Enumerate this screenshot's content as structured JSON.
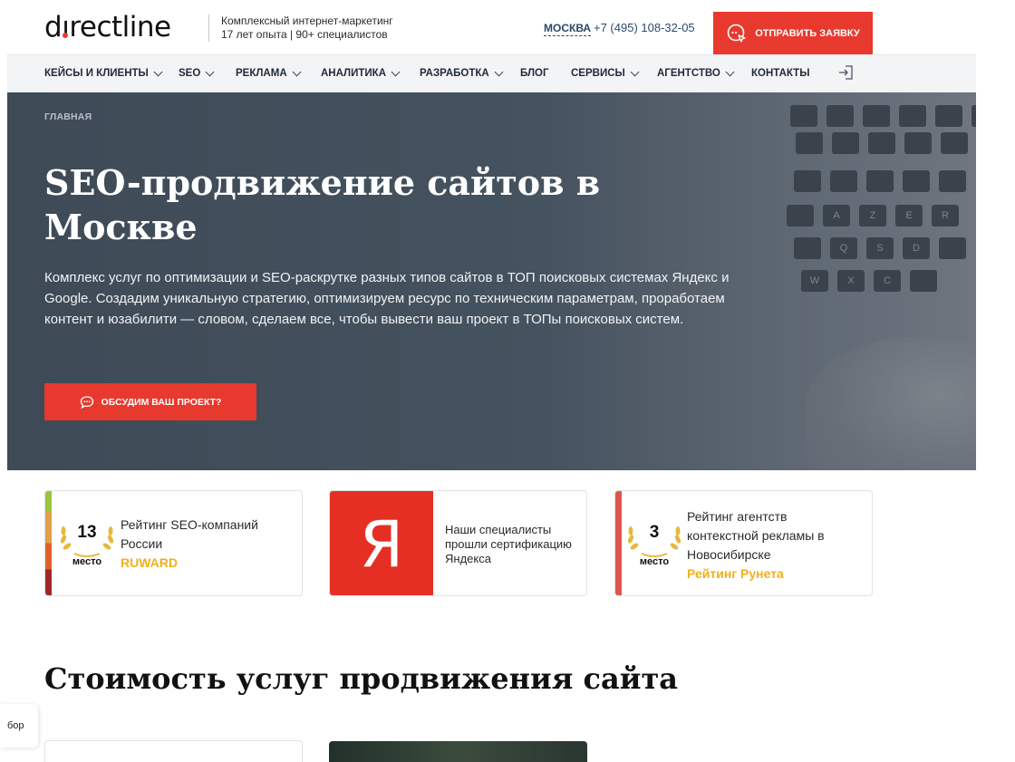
{
  "header": {
    "logo_before_i": "d",
    "logo_i": "ı",
    "logo_after_i": "rectline",
    "tagline_line1": "Комплексный интернет-маркетинг",
    "tagline_line2": "17 лет опыта | 90+ специалистов",
    "city": "МОСКВА",
    "phone": "+7 (495) 108-32-05",
    "cta_label": "ОТПРАВИТЬ ЗАЯВКУ",
    "brand_red": "#e8392e"
  },
  "nav": {
    "items": [
      {
        "label": "КЕЙСЫ И КЛИЕНТЫ",
        "has_dropdown": true
      },
      {
        "label": "SEO",
        "has_dropdown": true
      },
      {
        "label": "РЕКЛАМА",
        "has_dropdown": true
      },
      {
        "label": "АНАЛИТИКА",
        "has_dropdown": true
      },
      {
        "label": "РАЗРАБОТКА",
        "has_dropdown": true
      },
      {
        "label": "БЛОГ",
        "has_dropdown": false
      },
      {
        "label": "СЕРВИСЫ",
        "has_dropdown": true
      },
      {
        "label": "АГЕНТСТВО",
        "has_dropdown": true
      },
      {
        "label": "КОНТАКТЫ",
        "has_dropdown": false
      }
    ],
    "login_icon": "login-icon"
  },
  "hero": {
    "breadcrumb": "ГЛАВНАЯ",
    "title": "SEO-продвижение сайтов в Москве",
    "description": "Комплекс услуг по оптимизации и SEO-раскрутке разных типов сайтов в ТОП поисковых системах Яндекс и Google. Создадим уникальную стратегию, оптимизируем ресурс по техническим параметрам, проработаем контент и юзабилити — словом, сделаем все, чтобы вывести ваш проект в ТОПы поисковых систем.",
    "button_label": "ОБСУДИМ ВАШ ПРОЕКТ?",
    "keyboard_keys": [
      "",
      "",
      "",
      "",
      "",
      "",
      "A",
      "Z",
      "E",
      "R",
      "",
      "Q",
      "S",
      "D",
      "",
      "W",
      "X",
      "C"
    ]
  },
  "ratings": [
    {
      "place": "13",
      "place_word": "место",
      "text_line1": "Рейтинг SEO-компаний",
      "text_line2": "России",
      "source": "RUWARD"
    },
    {
      "ya_letter": "Я",
      "text": "Наши специалисты прошли сертификацию Яндекса"
    },
    {
      "place": "3",
      "place_word": "место",
      "text_line1": "Рейтинг агентств",
      "text_line2": "контекстной рекламы в",
      "text_line3": "Новосибирске",
      "source": "Рейтинг Рунета"
    }
  ],
  "pricing": {
    "title": "Стоимость услуг продвижения сайта"
  },
  "side_tab": {
    "label": "бор"
  }
}
